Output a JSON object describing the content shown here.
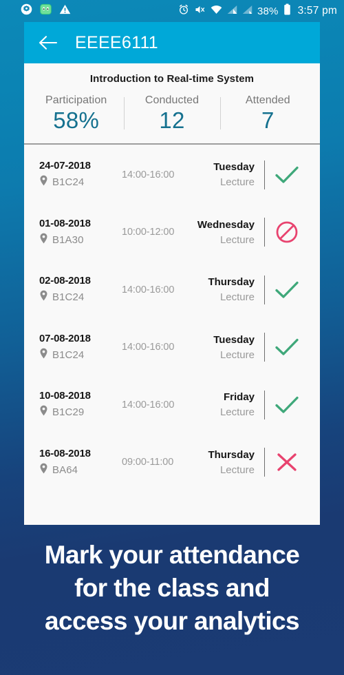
{
  "statusbar": {
    "left_icons": [
      "settings-gear-icon",
      "green-character-icon",
      "warning-triangle-icon"
    ],
    "right_icons": [
      "alarm-clock-icon",
      "sound-muted-icon",
      "wifi-icon",
      "signal-bars-icon",
      "signal-bars-2-icon"
    ],
    "battery_percent": "38%",
    "time": "3:57 pm"
  },
  "appbar": {
    "back_label": "back-arrow",
    "title": "EEEE6111"
  },
  "stats": {
    "course_title": "Introduction to Real-time System",
    "items": [
      {
        "label": "Participation",
        "value": "58%"
      },
      {
        "label": "Conducted",
        "value": "12"
      },
      {
        "label": "Attended",
        "value": "7"
      }
    ]
  },
  "sessions": [
    {
      "date": "24-07-2018",
      "time": "14:00-16:00",
      "room": "B1C24",
      "day": "Tuesday",
      "type": "Lecture",
      "status": "present"
    },
    {
      "date": "01-08-2018",
      "time": "10:00-12:00",
      "room": "B1A30",
      "day": "Wednesday",
      "type": "Lecture",
      "status": "cancelled"
    },
    {
      "date": "02-08-2018",
      "time": "14:00-16:00",
      "room": "B1C24",
      "day": "Thursday",
      "type": "Lecture",
      "status": "present"
    },
    {
      "date": "07-08-2018",
      "time": "14:00-16:00",
      "room": "B1C24",
      "day": "Tuesday",
      "type": "Lecture",
      "status": "present"
    },
    {
      "date": "10-08-2018",
      "time": "14:00-16:00",
      "room": "B1C29",
      "day": "Friday",
      "type": "Lecture",
      "status": "present"
    },
    {
      "date": "16-08-2018",
      "time": "09:00-11:00",
      "room": "BA64",
      "day": "Thursday",
      "type": "Lecture",
      "status": "absent"
    }
  ],
  "caption": {
    "line1": "Mark your attendance",
    "line2": "for the class and",
    "line3": "access your analytics"
  },
  "colors": {
    "appbar": "#00a8d8",
    "accent_teal": "#15718f",
    "present_green": "#3fa87a",
    "absent_pink": "#e8436f",
    "cancelled_pink": "#e8436f",
    "card_bg": "#f9f9f9"
  }
}
